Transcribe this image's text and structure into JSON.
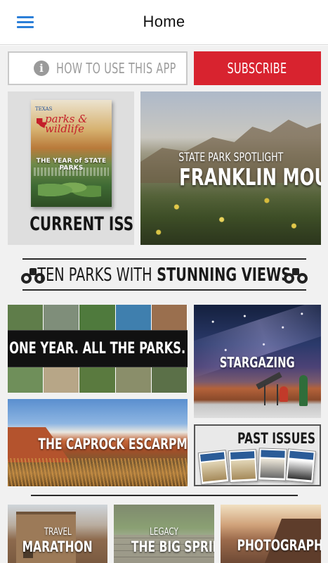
{
  "nav": {
    "title": "Home",
    "menu_icon": "hamburger-menu-icon"
  },
  "buttons": {
    "how_to": "HOW TO USE THIS APP",
    "how_to_icon": "info-icon",
    "subscribe": "SUBSCRIBE"
  },
  "current_issue": {
    "label": "CURRENT ISSUE",
    "cover": {
      "masthead_top": "TEXAS",
      "masthead": "parks & wildlife",
      "headline": "THE YEAR of STATE PARKS"
    }
  },
  "spotlight": {
    "kicker": "STATE PARK SPOTLIGHT",
    "title": "FRANKLIN MOUNTAINS"
  },
  "banner": {
    "light": "TEN PARKS WITH",
    "bold": "STUNNING VIEWS",
    "icon": "binoculars-icon"
  },
  "tiles": {
    "one_year": "ONE YEAR. ALL THE PARKS.",
    "stargazing": "STARGAZING",
    "caprock": "THE CAPROCK ESCARPMENT",
    "past_issues": "PAST ISSUES"
  },
  "bottom": [
    {
      "kicker": "TRAVEL",
      "title": "MARATHON"
    },
    {
      "kicker": "LEGACY",
      "title": "THE BIG SPRING"
    },
    {
      "kicker": "",
      "title": "PHOTOGRAPHY"
    }
  ],
  "colors": {
    "accent_blue": "#2b7fd8",
    "subscribe_red": "#d8232f"
  }
}
